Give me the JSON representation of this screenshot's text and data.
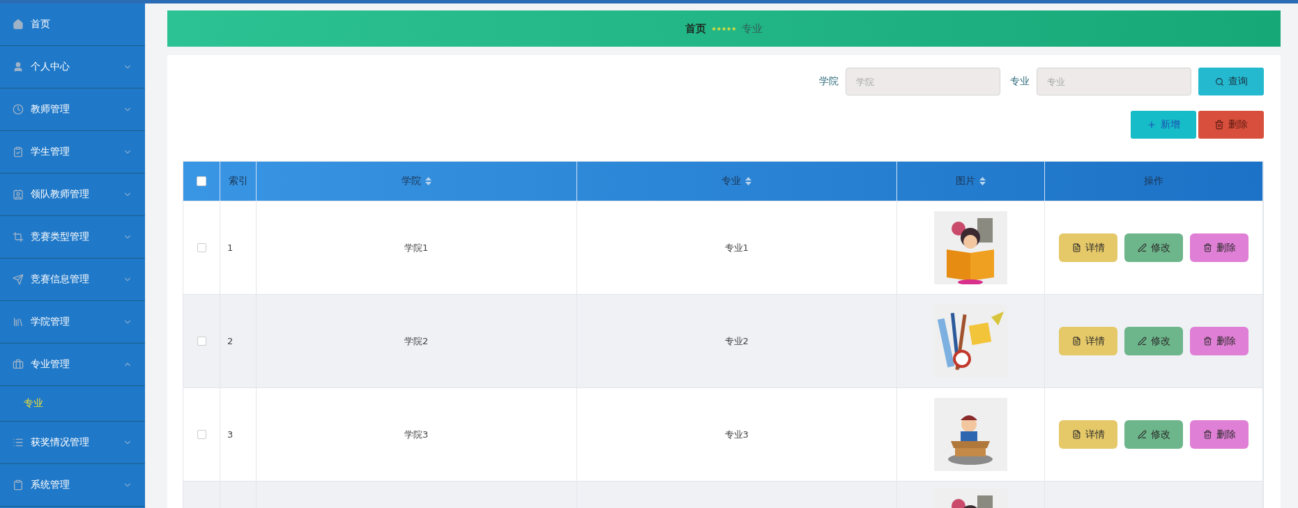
{
  "sidebar": {
    "items": [
      {
        "label": "首页"
      },
      {
        "label": "个人中心",
        "expanded": false
      },
      {
        "label": "教师管理",
        "expanded": false
      },
      {
        "label": "学生管理",
        "expanded": false
      },
      {
        "label": "领队教师管理",
        "expanded": false
      },
      {
        "label": "竞赛类型管理",
        "expanded": false
      },
      {
        "label": "竞赛信息管理",
        "expanded": false
      },
      {
        "label": "学院管理",
        "expanded": false
      },
      {
        "label": "专业管理",
        "expanded": true,
        "children": [
          {
            "label": "专业",
            "selected": true
          }
        ]
      },
      {
        "label": "获奖情况管理",
        "expanded": false
      },
      {
        "label": "系统管理",
        "expanded": false
      }
    ]
  },
  "breadcrumb": {
    "home": "首页",
    "separator": "★★★★★",
    "current": "专业"
  },
  "search": {
    "fields": [
      {
        "label": "学院",
        "placeholder": "学院"
      },
      {
        "label": "专业",
        "placeholder": "专业"
      }
    ],
    "button": "查询"
  },
  "actions": {
    "add": "新增",
    "delete": "删除"
  },
  "table": {
    "select_all": {
      "checked": false
    },
    "columns": [
      {
        "label": "索引",
        "sortable": false
      },
      {
        "label": "学院",
        "sortable": true
      },
      {
        "label": "专业",
        "sortable": true
      },
      {
        "label": "图片",
        "sortable": true
      },
      {
        "label": "操作",
        "sortable": false
      }
    ],
    "rows": [
      {
        "selected": false,
        "index": "1",
        "college": "学院1",
        "major": "专业1",
        "image": {
          "kind": "picture"
        },
        "buttons": [
          "详情",
          "修改",
          "删除"
        ]
      },
      {
        "selected": false,
        "index": "2",
        "college": "学院2",
        "major": "专业2",
        "image": {
          "kind": "picture"
        },
        "buttons": [
          "详情",
          "修改",
          "删除"
        ]
      },
      {
        "selected": false,
        "index": "3",
        "college": "学院3",
        "major": "专业3",
        "image": {
          "kind": "picture"
        },
        "buttons": [
          "详情",
          "修改",
          "删除"
        ]
      },
      {
        "image": {
          "kind": "picture"
        }
      }
    ]
  }
}
